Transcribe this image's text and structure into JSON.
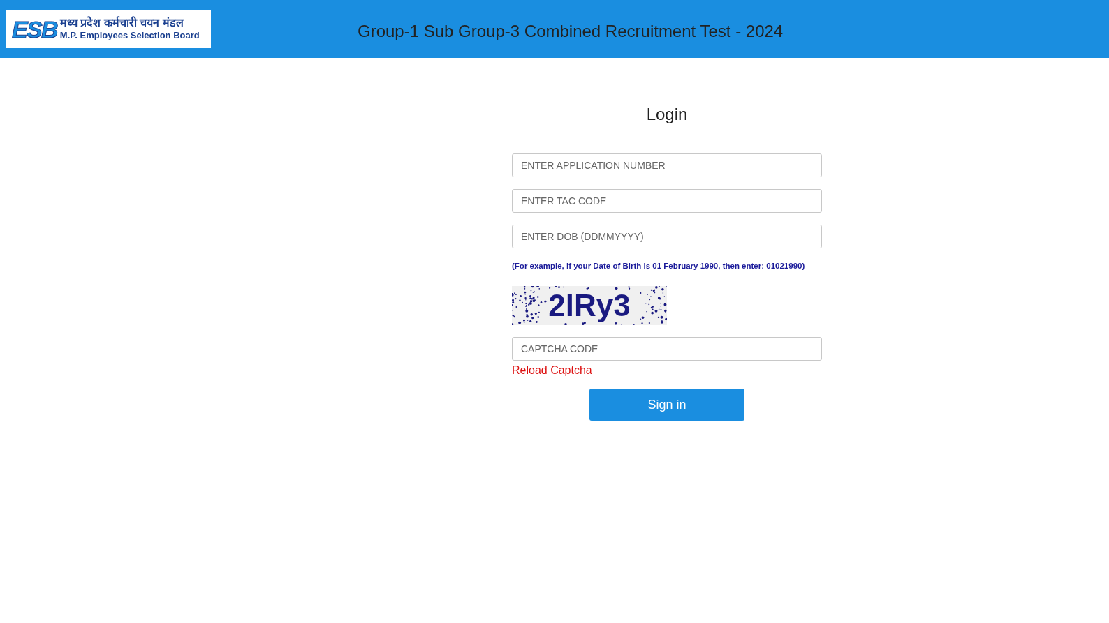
{
  "header": {
    "logo": {
      "mark": "ESB",
      "hindi_name": "मध्य प्रदेश कर्मचारी चयन मंडल",
      "english_name": "M.P. Employees Selection Board"
    },
    "title": "Group-1 Sub Group-3 Combined Recruitment Test - 2024"
  },
  "login": {
    "heading": "Login",
    "fields": [
      {
        "placeholder": "ENTER APPLICATION NUMBER"
      },
      {
        "placeholder": "ENTER TAC CODE"
      },
      {
        "placeholder": "ENTER DOB (DDMMYYYY)"
      }
    ],
    "hint": "(For example, if your Date of Birth is 01 February 1990, then enter: 01021990)",
    "captcha_text": "2lRy3",
    "captcha_field": {
      "placeholder": "CAPTCHA CODE"
    },
    "reload_link": "Reload Captcha",
    "submit": "Sign in"
  }
}
